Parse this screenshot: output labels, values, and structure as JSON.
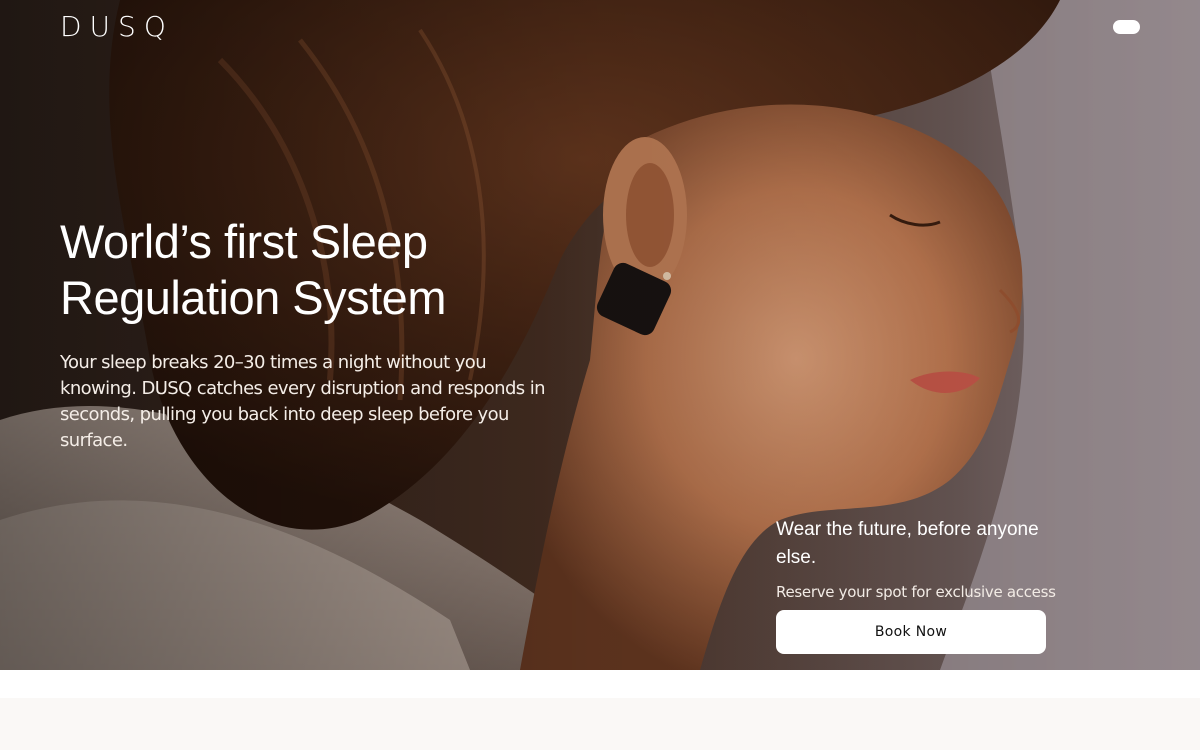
{
  "brand": {
    "logo_text": "DUSQ"
  },
  "nav": {
    "menu_icon": "menu-pill-icon"
  },
  "hero": {
    "headline_line1": "World’s first Sleep",
    "headline_line2": "Regulation System",
    "subcopy": "Your sleep breaks 20–30 times a night without you knowing. DUSQ catches every disruption and responds in seconds, pulling you back into deep sleep before you surface.",
    "photo_icon": "sleeping-woman-with-ear-device-photo"
  },
  "cta": {
    "title": "Wear the future, before anyone else.",
    "subtitle": "Reserve your spot for exclusive access",
    "button_label": "Book Now"
  },
  "colors": {
    "hero_dark": "#2a1c14",
    "hero_warm": "#c98a5e",
    "text_light": "#ffffff",
    "button_bg": "#ffffff",
    "lower_band": "#faf8f6"
  }
}
